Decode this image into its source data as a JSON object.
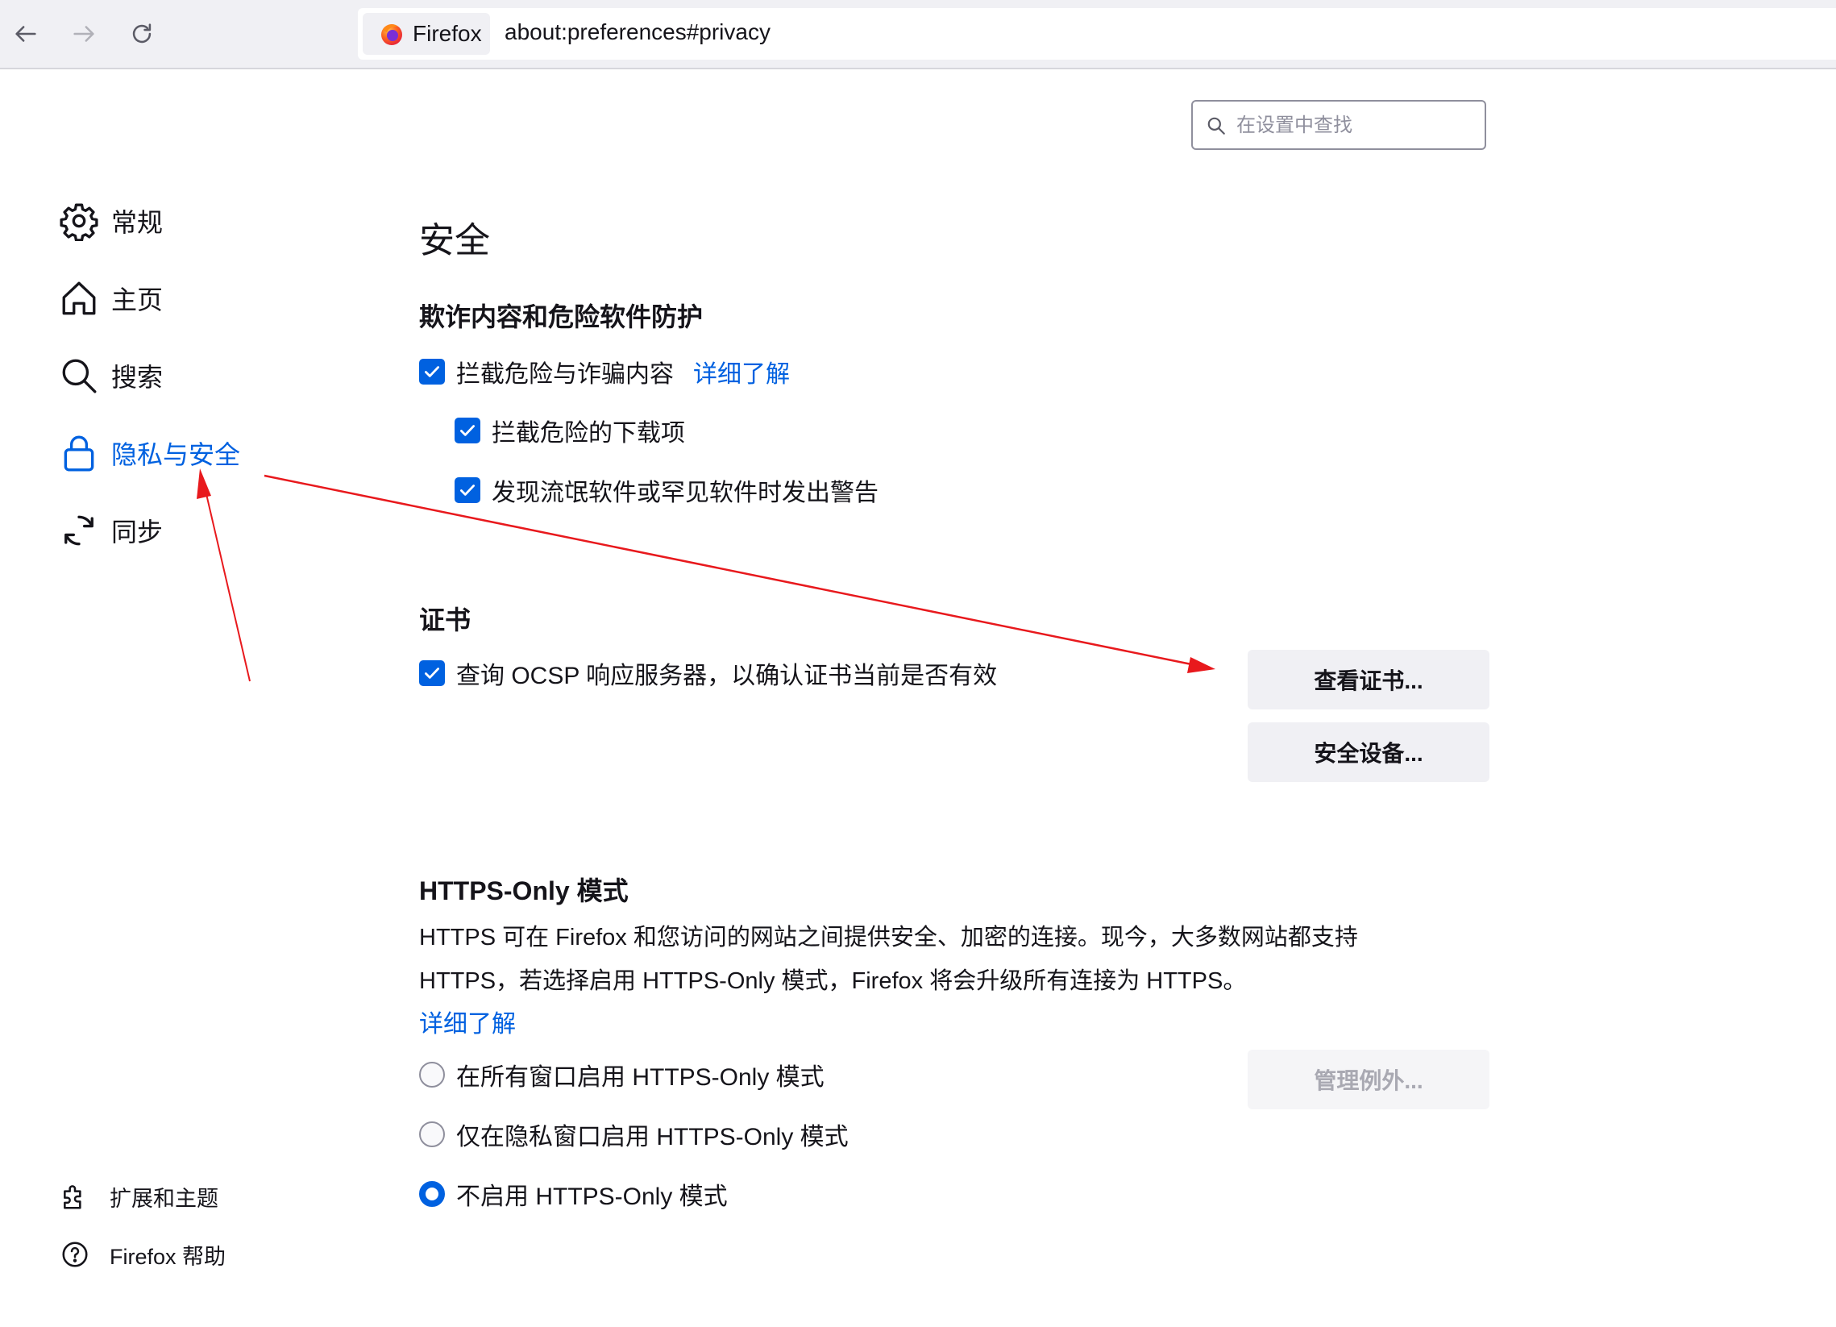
{
  "toolbar": {
    "back_label": "Back",
    "forward_label": "Forward",
    "reload_label": "Reload",
    "identity_label": "Firefox",
    "url": "about:preferences#privacy"
  },
  "search": {
    "placeholder": "在设置中查找",
    "value": ""
  },
  "sidebar": {
    "categories": [
      {
        "label": "常规",
        "icon": "gear-icon"
      },
      {
        "label": "主页",
        "icon": "home-icon"
      },
      {
        "label": "搜索",
        "icon": "search-icon"
      },
      {
        "label": "隐私与安全",
        "icon": "lock-icon",
        "selected": true
      },
      {
        "label": "同步",
        "icon": "sync-icon"
      }
    ],
    "footer": [
      {
        "label": "扩展和主题",
        "icon": "puzzle-icon"
      },
      {
        "label": "Firefox 帮助",
        "icon": "help-icon"
      }
    ]
  },
  "security": {
    "title": "安全",
    "fraud": {
      "heading": "欺诈内容和危险软件防护",
      "block_dangerous": {
        "label": "拦截危险与诈骗内容",
        "checked": true
      },
      "learn_more": "详细了解",
      "block_downloads": {
        "label": "拦截危险的下载项",
        "checked": true
      },
      "warn_unwanted": {
        "label": "发现流氓软件或罕见软件时发出警告",
        "checked": true
      }
    },
    "certificates": {
      "heading": "证书",
      "ocsp": {
        "label": "查询 OCSP 响应服务器，以确认证书当前是否有效",
        "checked": true
      },
      "view_button": "查看证书...",
      "devices_button": "安全设备..."
    }
  },
  "https_only": {
    "heading": "HTTPS-Only 模式",
    "description_line1": "HTTPS 可在 Firefox 和您访问的网站之间提供安全、加密的连接。现今，大多数网站都支持",
    "description_line2": "HTTPS，若选择启用 HTTPS-Only 模式，Firefox 将会升级所有连接为 HTTPS。",
    "learn_more": "详细了解",
    "options": [
      {
        "label": "在所有窗口启用 HTTPS-Only 模式",
        "checked": false
      },
      {
        "label": "仅在隐私窗口启用 HTTPS-Only 模式",
        "checked": false
      },
      {
        "label": "不启用 HTTPS-Only 模式",
        "checked": true
      }
    ],
    "exceptions_button": "管理例外...",
    "exceptions_button_disabled": true
  },
  "colors": {
    "accent": "#0061e0",
    "annotation": "#e8191d",
    "toolbar_bg": "#f0f0f4"
  }
}
